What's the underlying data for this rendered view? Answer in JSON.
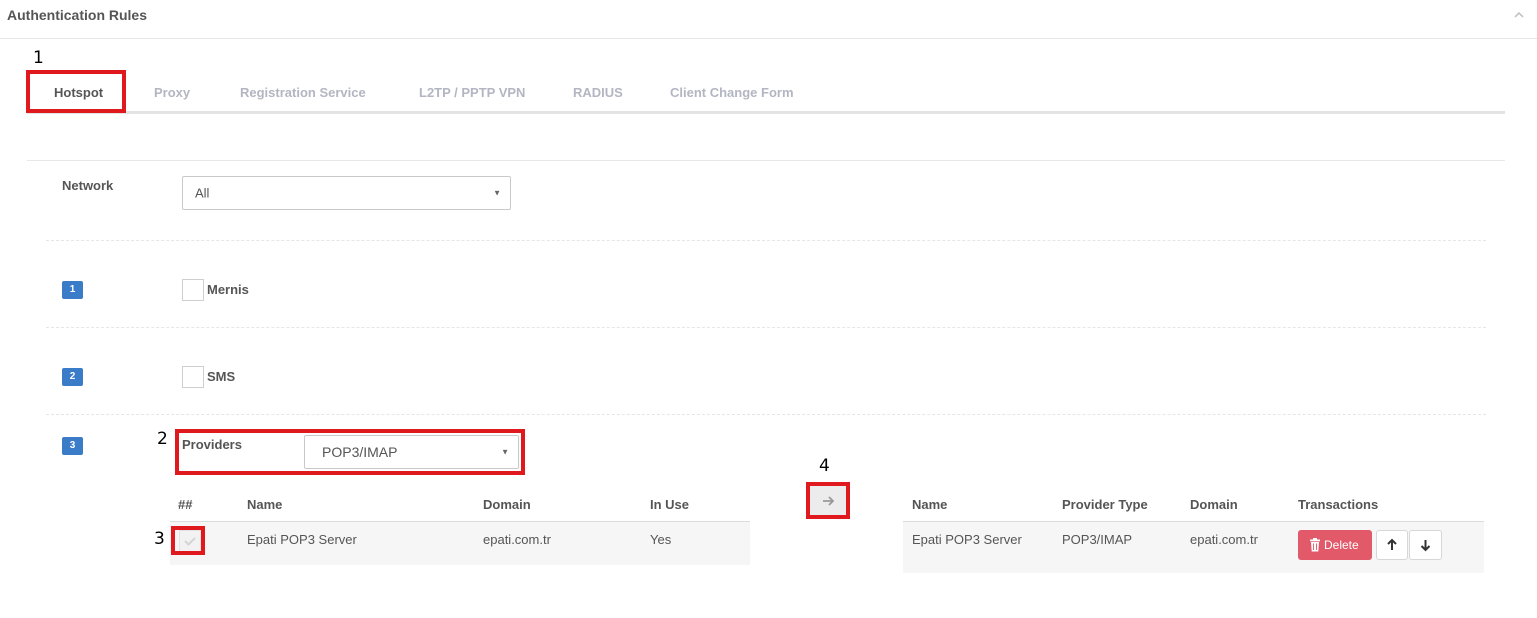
{
  "panel": {
    "title": "Authentication Rules"
  },
  "tabs": [
    {
      "label": "Hotspot",
      "active": true
    },
    {
      "label": "Proxy"
    },
    {
      "label": "Registration Service"
    },
    {
      "label": "L2TP / PPTP VPN"
    },
    {
      "label": "RADIUS"
    },
    {
      "label": "Client Change Form"
    }
  ],
  "network": {
    "label": "Network",
    "value": "All"
  },
  "rules": [
    {
      "badge": "1",
      "label": "Mernis",
      "checked": false
    },
    {
      "badge": "2",
      "label": "SMS",
      "checked": false
    },
    {
      "badge": "3"
    }
  ],
  "providers": {
    "label": "Providers",
    "value": "POP3/IMAP"
  },
  "left_table": {
    "headers": [
      "##",
      "Name",
      "Domain",
      "In Use"
    ],
    "rows": [
      {
        "name": "Epati POP3 Server",
        "domain": "epati.com.tr",
        "in_use": "Yes",
        "checked": true
      }
    ]
  },
  "right_table": {
    "headers": [
      "Name",
      "Provider Type",
      "Domain",
      "Transactions"
    ],
    "rows": [
      {
        "name": "Epati POP3 Server",
        "provider_type": "POP3/IMAP",
        "domain": "epati.com.tr",
        "delete_label": "Delete"
      }
    ]
  },
  "annotations": [
    "1",
    "2",
    "3",
    "4"
  ],
  "colors": {
    "badge": "#3b7cc9",
    "annotation": "#e0191f",
    "delete": "#e2596a"
  }
}
